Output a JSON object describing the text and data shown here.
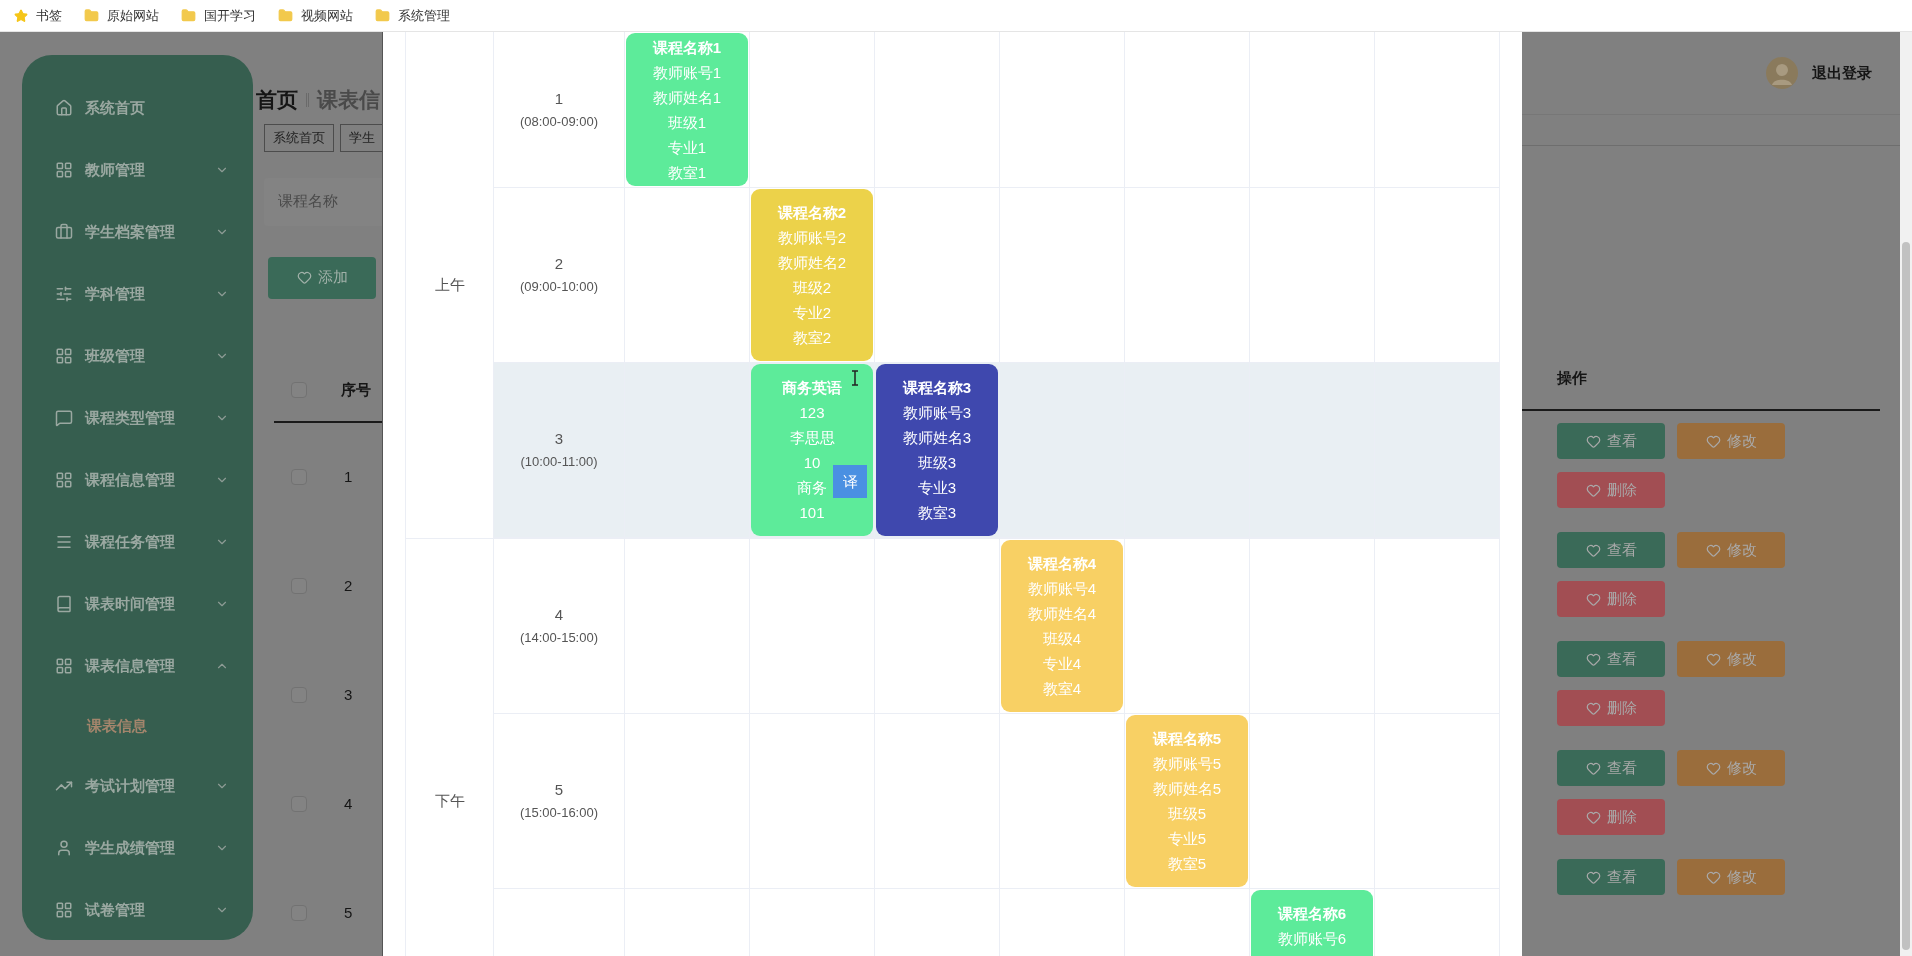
{
  "bookmarks": [
    {
      "kind": "star",
      "label": "书签"
    },
    {
      "kind": "folder",
      "label": "原始网站"
    },
    {
      "kind": "folder",
      "label": "国开学习"
    },
    {
      "kind": "folder",
      "label": "视频网站"
    },
    {
      "kind": "folder",
      "label": "系统管理"
    }
  ],
  "sidebar": {
    "items": [
      {
        "label": "系统首页",
        "kind": "link"
      },
      {
        "label": "教师管理",
        "kind": "group",
        "expanded": false
      },
      {
        "label": "学生档案管理",
        "kind": "group",
        "expanded": false
      },
      {
        "label": "学科管理",
        "kind": "group",
        "expanded": false
      },
      {
        "label": "班级管理",
        "kind": "group",
        "expanded": false
      },
      {
        "label": "课程类型管理",
        "kind": "group",
        "expanded": false
      },
      {
        "label": "课程信息管理",
        "kind": "group",
        "expanded": false
      },
      {
        "label": "课程任务管理",
        "kind": "group",
        "expanded": false
      },
      {
        "label": "课表时间管理",
        "kind": "group",
        "expanded": false
      },
      {
        "label": "课表信息管理",
        "kind": "group",
        "expanded": true,
        "children": [
          {
            "label": "课表信息",
            "selected": true
          }
        ]
      },
      {
        "label": "考试计划管理",
        "kind": "group",
        "expanded": false
      },
      {
        "label": "学生成绩管理",
        "kind": "group",
        "expanded": false
      },
      {
        "label": "试卷管理",
        "kind": "group",
        "expanded": false
      }
    ]
  },
  "header": {
    "home": "首页",
    "current": "课表信",
    "logout": "退出登录"
  },
  "tags": [
    "系统首页",
    "学生"
  ],
  "search": {
    "placeholder": "课程名称"
  },
  "add_button": "添加",
  "table": {
    "header_checked": false,
    "columns": [
      "序号",
      "操作"
    ],
    "rows": [
      {
        "index": "1",
        "checked": false,
        "buttons": [
          {
            "kind": "view",
            "label": "查看"
          },
          {
            "kind": "edit",
            "label": "修改"
          },
          {
            "kind": "delete",
            "label": "删除"
          }
        ]
      },
      {
        "index": "2",
        "checked": false,
        "buttons": [
          {
            "kind": "view",
            "label": "查看"
          },
          {
            "kind": "edit",
            "label": "修改"
          },
          {
            "kind": "delete",
            "label": "删除"
          }
        ]
      },
      {
        "index": "3",
        "checked": false,
        "buttons": [
          {
            "kind": "view",
            "label": "查看"
          },
          {
            "kind": "edit",
            "label": "修改"
          },
          {
            "kind": "delete",
            "label": "删除"
          }
        ]
      },
      {
        "index": "4",
        "checked": false,
        "buttons": [
          {
            "kind": "view",
            "label": "查看"
          },
          {
            "kind": "edit",
            "label": "修改"
          },
          {
            "kind": "delete",
            "label": "删除"
          }
        ]
      },
      {
        "index": "5",
        "checked": false,
        "buttons": [
          {
            "kind": "view",
            "label": "查看"
          },
          {
            "kind": "edit",
            "label": "修改"
          }
        ]
      }
    ]
  },
  "timetable": {
    "periods": [
      {
        "label": "上午",
        "slots": [
          {
            "number": "1",
            "time": "(08:00-09:00)",
            "highlighted": false,
            "cells": [
              {
                "color": "#5deb9a",
                "lines": [
                  "课程名称1",
                  "教师账号1",
                  "教师姓名1",
                  "班级1",
                  "专业1",
                  "教室1"
                ]
              },
              null,
              null,
              null,
              null,
              null,
              null
            ]
          },
          {
            "number": "2",
            "time": "(09:00-10:00)",
            "highlighted": false,
            "cells": [
              null,
              {
                "color": "#ecd24a",
                "lines": [
                  "课程名称2",
                  "教师账号2",
                  "教师姓名2",
                  "班级2",
                  "专业2",
                  "教室2"
                ]
              },
              null,
              null,
              null,
              null,
              null
            ]
          },
          {
            "number": "3",
            "time": "(10:00-11:00)",
            "highlighted": true,
            "cells": [
              null,
              {
                "color": "#5deb9a",
                "lines": [
                  "商务英语",
                  "123",
                  "李思思",
                  "10",
                  "商务",
                  "101"
                ],
                "popup": "译"
              },
              {
                "color": "#3f48ae",
                "lines": [
                  "课程名称3",
                  "教师账号3",
                  "教师姓名3",
                  "班级3",
                  "专业3",
                  "教室3"
                ]
              },
              null,
              null,
              null,
              null
            ]
          }
        ]
      },
      {
        "label": "下午",
        "slots": [
          {
            "number": "4",
            "time": "(14:00-15:00)",
            "highlighted": false,
            "cells": [
              null,
              null,
              null,
              {
                "color": "#f8d064",
                "lines": [
                  "课程名称4",
                  "教师账号4",
                  "教师姓名4",
                  "班级4",
                  "专业4",
                  "教室4"
                ]
              },
              null,
              null,
              null
            ]
          },
          {
            "number": "5",
            "time": "(15:00-16:00)",
            "highlighted": false,
            "cells": [
              null,
              null,
              null,
              null,
              {
                "color": "#f8d064",
                "lines": [
                  "课程名称5",
                  "教师账号5",
                  "教师姓名5",
                  "班级5",
                  "专业5",
                  "教室5"
                ]
              },
              null,
              null
            ]
          },
          {
            "highlighted": false,
            "cells": [
              null,
              null,
              null,
              null,
              null,
              {
                "color": "#5deb9a",
                "lines": [
                  "课程名称6",
                  "教师账号6"
                ]
              },
              null
            ]
          }
        ]
      }
    ]
  }
}
